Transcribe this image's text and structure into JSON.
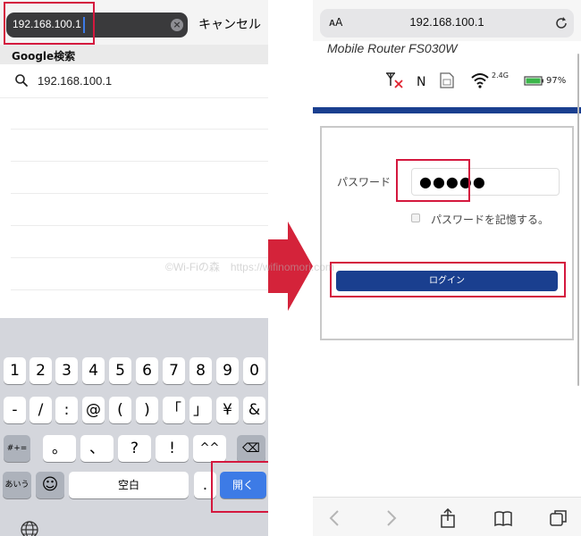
{
  "left": {
    "url_input": "192.168.100.1",
    "cancel_label": "キャンセル",
    "section_title": "Google検索",
    "suggestion": "192.168.100.1",
    "keyboard": {
      "row1": [
        "1",
        "2",
        "3",
        "4",
        "5",
        "6",
        "7",
        "8",
        "9",
        "0"
      ],
      "row2": [
        "-",
        "/",
        ":",
        "@",
        "(",
        ")",
        "「",
        "」",
        "¥",
        "&"
      ],
      "row3": [
        "#+=",
        "。",
        "、",
        "?",
        "!",
        "^^",
        "⌫"
      ],
      "row4": [
        "あいう",
        "☺",
        "空白",
        ".",
        "開く"
      ],
      "globe": "🌐"
    }
  },
  "right": {
    "aa": "ᴀA",
    "url": "192.168.100.1",
    "model": "Mobile Router FS030W",
    "status": {
      "network": "N",
      "wifi_band": "2.4G",
      "battery": "97%"
    },
    "password_label": "パスワード",
    "password_value": "●●●●●",
    "remember_label": "パスワードを記憶する。",
    "login_label": "ログイン"
  },
  "watermark": "©Wi-Fiの森　https://wifinomori.com",
  "colors": {
    "highlight": "#d4183e",
    "brand_blue": "#1a3f8f",
    "key_blue": "#3d7be6",
    "arrow": "#d4233a"
  }
}
